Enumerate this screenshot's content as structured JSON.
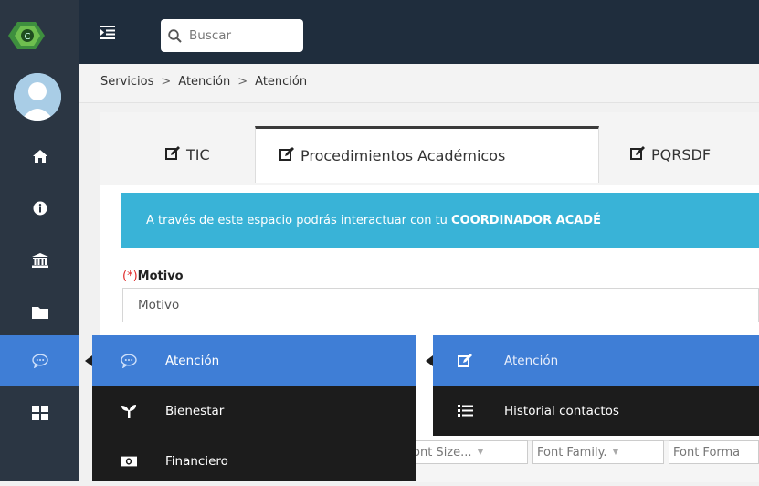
{
  "header": {
    "search_placeholder": "Buscar"
  },
  "breadcrumb": [
    "Servicios",
    "Atención",
    "Atención"
  ],
  "breadcrumb_separator": ">",
  "tabs": [
    {
      "label": "TIC",
      "icon": "edit-icon",
      "active": false
    },
    {
      "label": "Procedimientos Académicos",
      "icon": "edit-icon",
      "active": true
    },
    {
      "label": "PQRSDF",
      "icon": "edit-icon",
      "active": false
    }
  ],
  "alert": {
    "text": "A través de este espacio podrás interactuar con tu ",
    "bold": "COORDINADOR ACADÉ"
  },
  "form": {
    "required_mark": "(*)",
    "motivo_label": "Motivo",
    "motivo_placeholder": "Motivo"
  },
  "sidebar_icons": [
    "home-icon",
    "info-icon",
    "institution-icon",
    "folder-icon",
    "chat-icon",
    "grid-icon"
  ],
  "submenu": [
    {
      "label": "Atención",
      "icon": "chat-icon",
      "active": true
    },
    {
      "label": "Bienestar",
      "icon": "sprout-icon",
      "active": false
    },
    {
      "label": "Financiero",
      "icon": "money-icon",
      "active": false
    }
  ],
  "submenu2": [
    {
      "label": "Atención",
      "icon": "edit-icon",
      "active": true
    },
    {
      "label": "Historial contactos",
      "icon": "list-icon",
      "active": false
    }
  ],
  "editor_toolbar": {
    "font_size": "Font Size...",
    "font_family": "Font Family.",
    "font_format": "Font Forma"
  },
  "colors": {
    "sidebar": "#2b3643",
    "topbar": "#1f2d3d",
    "accent": "#3f7ed6",
    "alert": "#39b3d7",
    "submenu": "#1c1c1c"
  }
}
